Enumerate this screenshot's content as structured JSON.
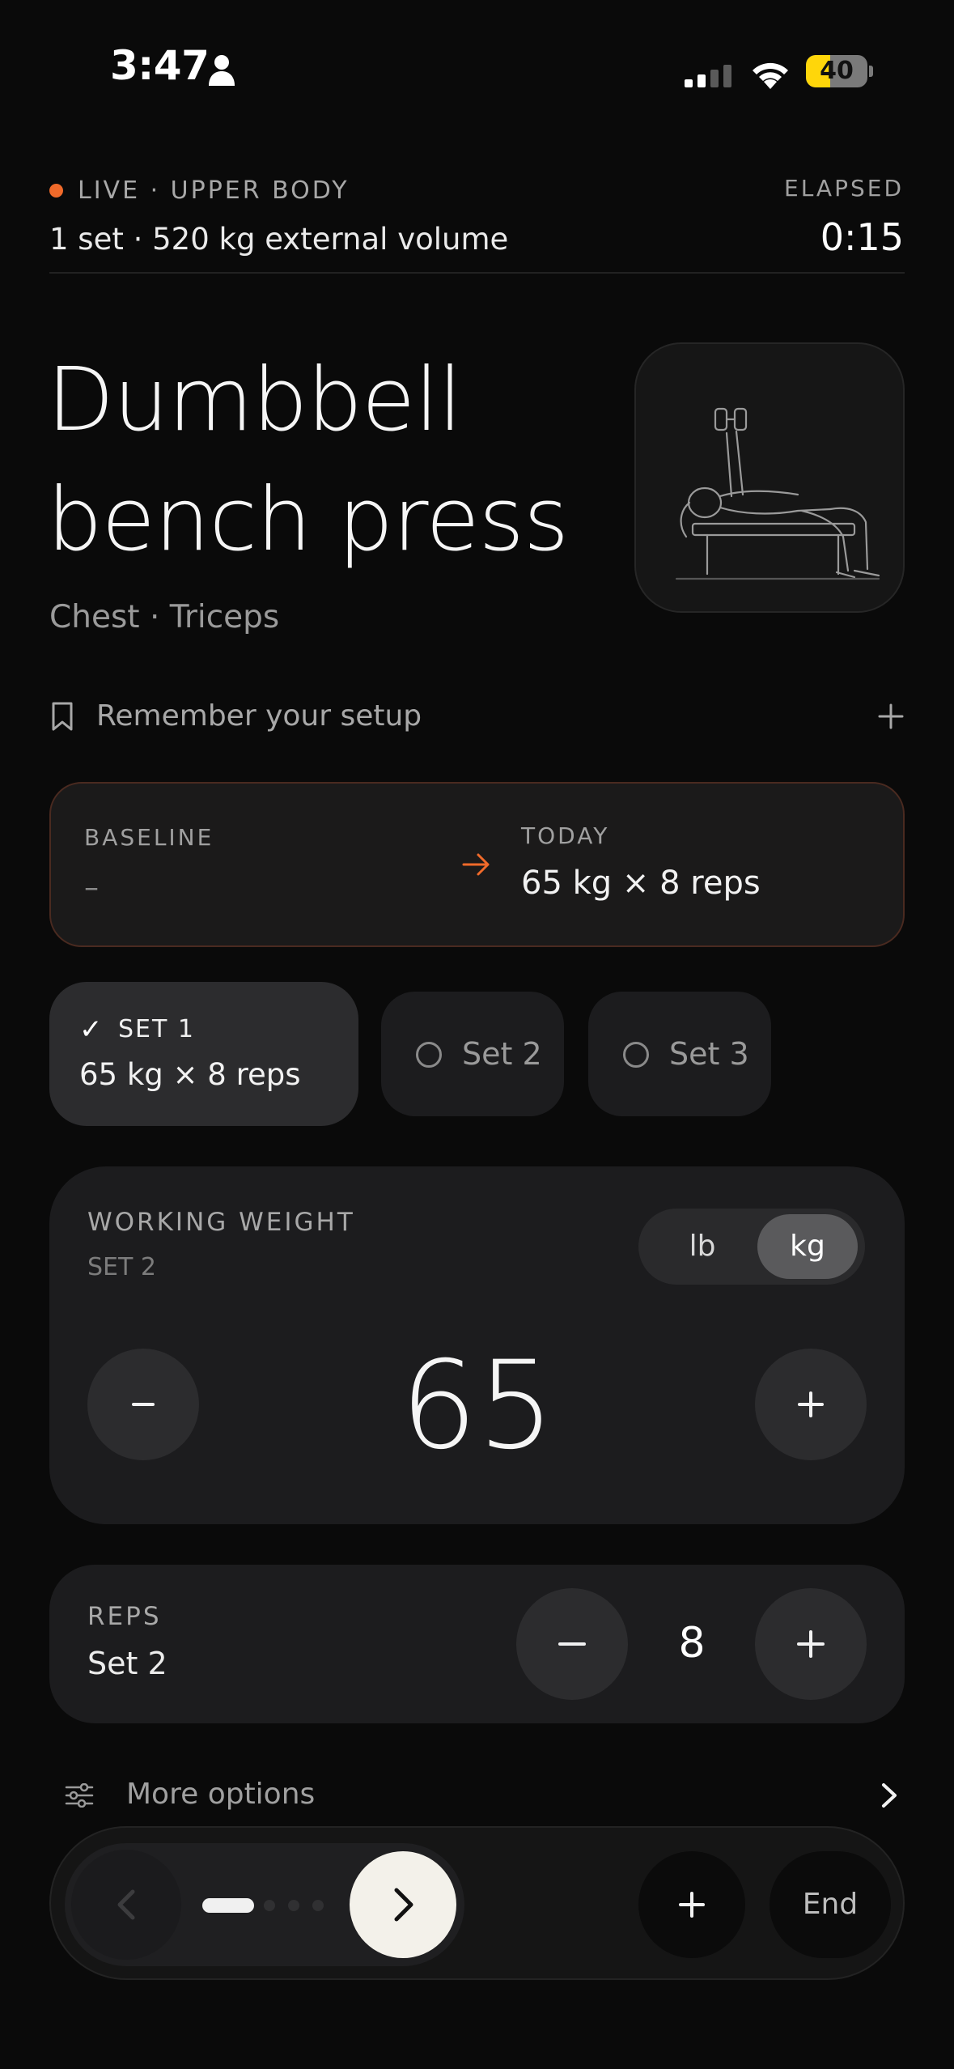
{
  "status_bar": {
    "time": "3:47",
    "battery_level": "40",
    "battery_fraction": 0.4
  },
  "header": {
    "live_label": "LIVE · UPPER BODY",
    "summary": "1 set · 520 kg external volume",
    "elapsed_label": "ELAPSED",
    "elapsed_value": "0:15"
  },
  "exercise": {
    "title_line1": "Dumbbell",
    "title_line2": "bench press",
    "muscles": "Chest · Triceps"
  },
  "setup": {
    "label": "Remember your setup"
  },
  "comparison": {
    "baseline_label": "BASELINE",
    "baseline_value": "–",
    "today_label": "TODAY",
    "today_value": "65 kg × 8 reps"
  },
  "sets": [
    {
      "label": "SET 1",
      "value": "65 kg × 8 reps",
      "done": true
    },
    {
      "label": "Set 2",
      "done": false
    },
    {
      "label": "Set 3",
      "done": false
    }
  ],
  "working_weight": {
    "label": "WORKING WEIGHT",
    "sub": "SET 2",
    "units": [
      "lb",
      "kg"
    ],
    "selected_unit": "kg",
    "value": "65"
  },
  "reps": {
    "label": "REPS",
    "sub": "Set 2",
    "value": "8"
  },
  "more": {
    "label": "More options"
  },
  "bottom_bar": {
    "end_label": "End"
  },
  "colors": {
    "accent": "#f06a2a",
    "background": "#0a0a0a",
    "card": "#1c1c1e"
  }
}
